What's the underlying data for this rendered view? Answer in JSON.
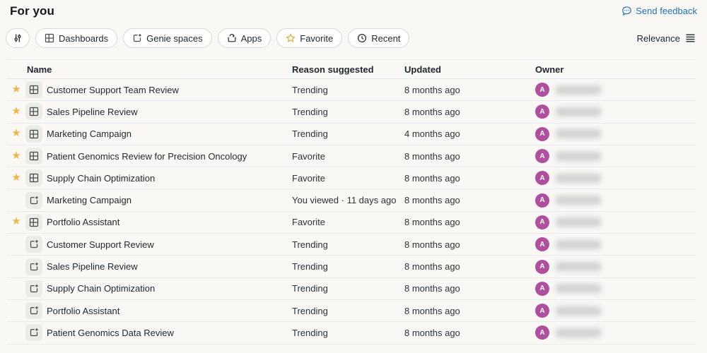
{
  "page": {
    "title": "For you"
  },
  "feedback": {
    "label": "Send feedback"
  },
  "sort": {
    "label": "Relevance"
  },
  "colors": {
    "link_blue": "#2272b4",
    "star_gold": "#f2b648",
    "avatar_magenta": "#b04f9d",
    "background": "#f9f8f5"
  },
  "filters": {
    "pills": [
      {
        "id": "filter",
        "label": "",
        "icon": "filter-sliders-icon"
      },
      {
        "id": "dashboards",
        "label": "Dashboards",
        "icon": "dashboard-icon"
      },
      {
        "id": "genie",
        "label": "Genie spaces",
        "icon": "genie-space-icon"
      },
      {
        "id": "apps",
        "label": "Apps",
        "icon": "apps-icon"
      },
      {
        "id": "favorite",
        "label": "Favorite",
        "icon": "star-outline-icon"
      },
      {
        "id": "recent",
        "label": "Recent",
        "icon": "clock-icon"
      }
    ]
  },
  "table": {
    "columns": [
      "Name",
      "Reason suggested",
      "Updated",
      "Owner"
    ],
    "rows": [
      {
        "starred": true,
        "type": "dashboard",
        "name": "Customer Support Team Review",
        "reason": "Trending",
        "updated": "8 months ago",
        "owner_initial": "A",
        "owner_name_redacted": true
      },
      {
        "starred": true,
        "type": "dashboard",
        "name": "Sales Pipeline Review",
        "reason": "Trending",
        "updated": "8 months ago",
        "owner_initial": "A",
        "owner_name_redacted": true
      },
      {
        "starred": true,
        "type": "dashboard",
        "name": "Marketing Campaign",
        "reason": "Trending",
        "updated": "4 months ago",
        "owner_initial": "A",
        "owner_name_redacted": true
      },
      {
        "starred": true,
        "type": "dashboard",
        "name": "Patient Genomics Review for Precision Oncology",
        "reason": "Favorite",
        "updated": "8 months ago",
        "owner_initial": "A",
        "owner_name_redacted": true
      },
      {
        "starred": true,
        "type": "dashboard",
        "name": "Supply Chain Optimization",
        "reason": "Favorite",
        "updated": "8 months ago",
        "owner_initial": "A",
        "owner_name_redacted": true
      },
      {
        "starred": false,
        "type": "genie",
        "name": "Marketing Campaign",
        "reason": "You viewed · 11 days ago",
        "updated": "8 months ago",
        "owner_initial": "A",
        "owner_name_redacted": true
      },
      {
        "starred": true,
        "type": "dashboard",
        "name": "Portfolio Assistant",
        "reason": "Favorite",
        "updated": "8 months ago",
        "owner_initial": "A",
        "owner_name_redacted": true
      },
      {
        "starred": false,
        "type": "genie",
        "name": "Customer Support Review",
        "reason": "Trending",
        "updated": "8 months ago",
        "owner_initial": "A",
        "owner_name_redacted": true
      },
      {
        "starred": false,
        "type": "genie",
        "name": "Sales Pipeline Review",
        "reason": "Trending",
        "updated": "8 months ago",
        "owner_initial": "A",
        "owner_name_redacted": true
      },
      {
        "starred": false,
        "type": "genie",
        "name": "Supply Chain Optimization",
        "reason": "Trending",
        "updated": "8 months ago",
        "owner_initial": "A",
        "owner_name_redacted": true
      },
      {
        "starred": false,
        "type": "genie",
        "name": "Portfolio Assistant",
        "reason": "Trending",
        "updated": "8 months ago",
        "owner_initial": "A",
        "owner_name_redacted": true
      },
      {
        "starred": false,
        "type": "genie",
        "name": "Patient Genomics Data Review",
        "reason": "Trending",
        "updated": "8 months ago",
        "owner_initial": "A",
        "owner_name_redacted": true
      }
    ]
  }
}
